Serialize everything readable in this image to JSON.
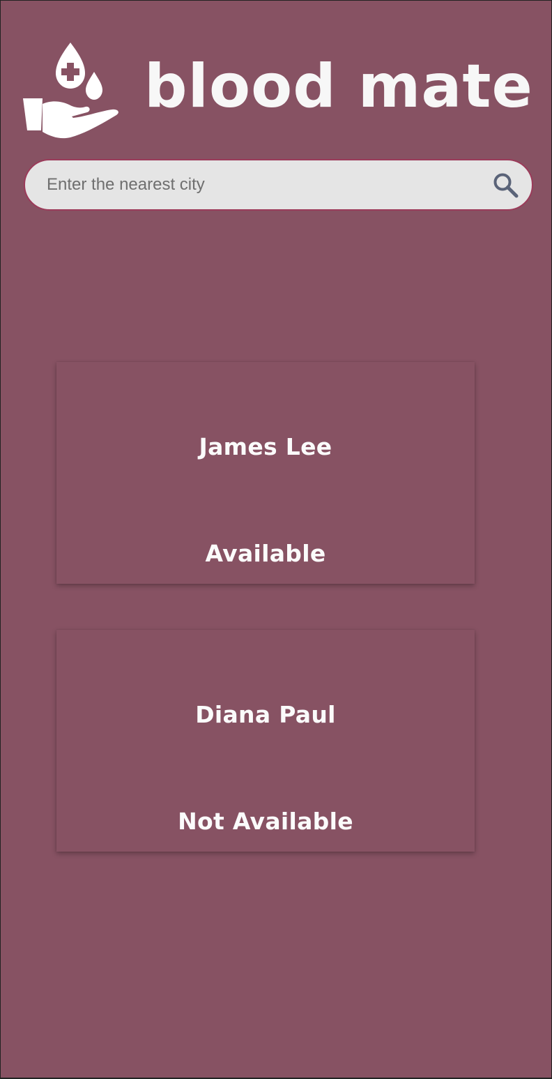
{
  "brand": {
    "name": "blood mate",
    "logo_icon": "blood-drop-hand-icon"
  },
  "search": {
    "placeholder": "Enter the nearest city",
    "value": "",
    "icon": "search-icon"
  },
  "donors": [
    {
      "name": "James Lee",
      "status": "Available"
    },
    {
      "name": "Diana Paul",
      "status": "Not Available"
    }
  ],
  "colors": {
    "background": "#875263",
    "search_border": "#9b3b5a",
    "search_fill": "#e5e5e5",
    "search_icon": "#5a6378",
    "text": "#ffffff"
  }
}
